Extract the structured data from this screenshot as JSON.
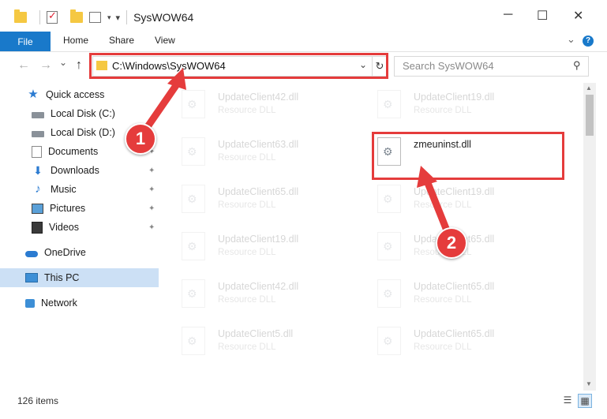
{
  "window": {
    "title": "SysWOW64",
    "minimize_glyph": "─",
    "maximize_glyph": "☐",
    "close_glyph": "✕"
  },
  "ribbon": {
    "tabs": [
      "File",
      "Home",
      "Share",
      "View"
    ],
    "expand_glyph": "⌄",
    "help_glyph": "?"
  },
  "nav": {
    "back_glyph": "←",
    "forward_glyph": "→",
    "recent_glyph": "⌄",
    "up_glyph": "↑",
    "address": "C:\\Windows\\SysWOW64",
    "address_dropdown_glyph": "⌄",
    "refresh_glyph": "↻",
    "search_placeholder": "Search SysWOW64",
    "search_icon_glyph": "⚲"
  },
  "sidebar": {
    "items": [
      {
        "label": "Quick access",
        "icon": "star-icon"
      },
      {
        "label": "Local Disk (C:)",
        "icon": "disk-icon"
      },
      {
        "label": "Local Disk (D:)",
        "icon": "disk-icon"
      },
      {
        "label": "Documents",
        "icon": "documents-icon",
        "pinned": true
      },
      {
        "label": "Downloads",
        "icon": "downloads-icon",
        "pinned": true
      },
      {
        "label": "Music",
        "icon": "music-icon",
        "pinned": true
      },
      {
        "label": "Pictures",
        "icon": "pictures-icon",
        "pinned": true
      },
      {
        "label": "Videos",
        "icon": "videos-icon",
        "pinned": true
      },
      {
        "label": "OneDrive",
        "icon": "onedrive-icon"
      },
      {
        "label": "This PC",
        "icon": "this-pc-icon",
        "selected": true
      },
      {
        "label": "Network",
        "icon": "network-icon"
      }
    ],
    "pin_glyph": "📌"
  },
  "files": {
    "left_column": [
      {
        "name": "UpdateClient42.dll",
        "type": "Resource DLL"
      },
      {
        "name": "UpdateClient63.dll",
        "type": "Resource DLL"
      },
      {
        "name": "UpdateClient65.dll",
        "type": "Resource DLL"
      },
      {
        "name": "UpdateClient19.dll",
        "type": "Resource DLL"
      },
      {
        "name": "UpdateClient42.dll",
        "type": "Resource DLL"
      },
      {
        "name": "UpdateClient5.dll",
        "type": "Resource DLL"
      }
    ],
    "right_column": [
      {
        "name": "UpdateClient19.dll",
        "type": "Resource DLL"
      },
      {
        "name": "zmeuninst.dll",
        "type": "",
        "highlighted": true
      },
      {
        "name": "UpdateClient19.dll",
        "type": "Resource DLL"
      },
      {
        "name": "UpdateClient65.dll",
        "type": "Resource DLL"
      },
      {
        "name": "UpdateClient65.dll",
        "type": "Resource DLL"
      },
      {
        "name": "UpdateClient65.dll",
        "type": "Resource DLL"
      }
    ]
  },
  "scrollbar": {
    "up_glyph": "▲",
    "down_glyph": "▼"
  },
  "status": {
    "item_count": "126 items",
    "details_view_glyph": "☰",
    "large_icons_view_glyph": "▦"
  },
  "annotations": {
    "callout_1": "1",
    "callout_2": "2",
    "highlight_color": "#e53c3c"
  }
}
